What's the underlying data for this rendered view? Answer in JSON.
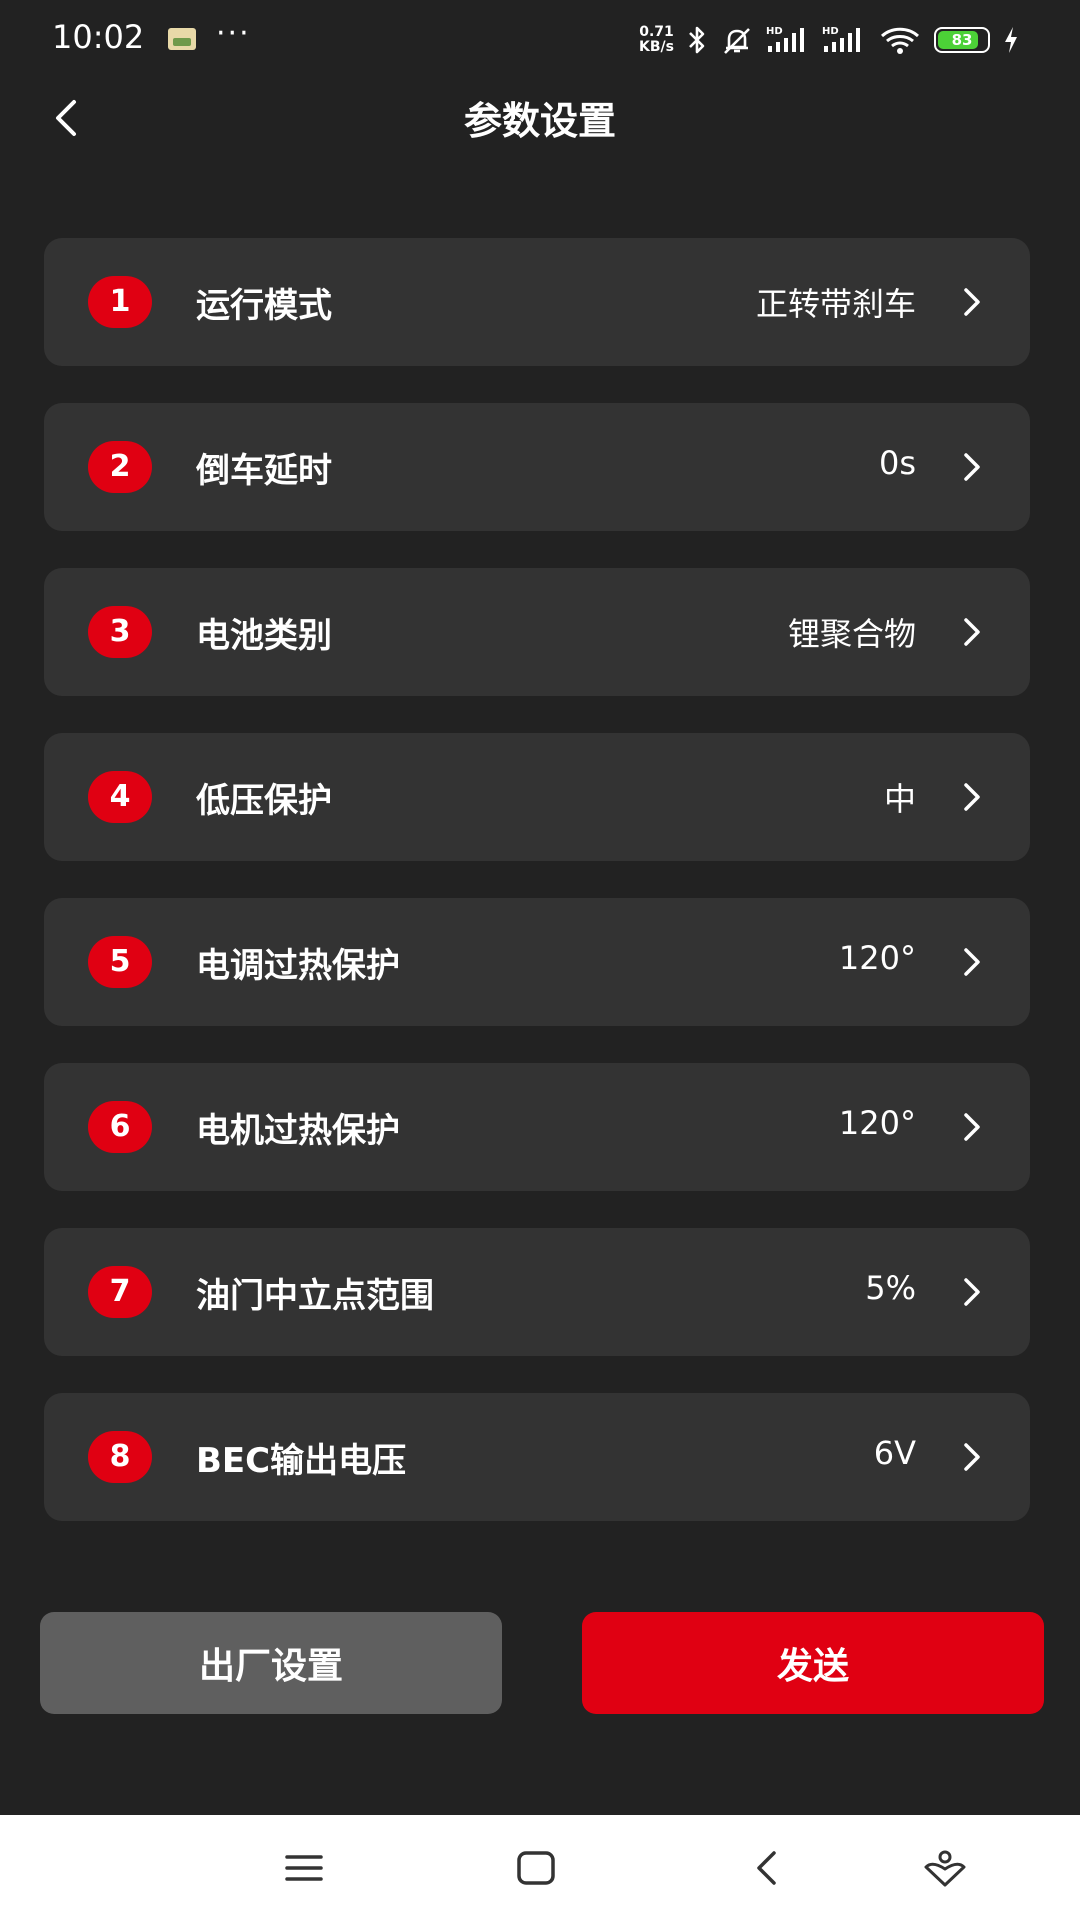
{
  "status_bar": {
    "time": "10:02",
    "more": "···",
    "net_speed_value": "0.71",
    "net_speed_unit": "KB/s",
    "battery_level": "83",
    "icons": [
      "photo-notification-icon",
      "bluetooth-icon",
      "bell-off-icon",
      "signal-hd-icon",
      "signal-hd-icon",
      "wifi-icon",
      "battery-icon",
      "charging-icon"
    ]
  },
  "header": {
    "title": "参数设置",
    "back_icon": "chevron-left-icon"
  },
  "settings": [
    {
      "index": "1",
      "label": "运行模式",
      "value": "正转带刹车"
    },
    {
      "index": "2",
      "label": "倒车延时",
      "value": "0s"
    },
    {
      "index": "3",
      "label": "电池类别",
      "value": "锂聚合物"
    },
    {
      "index": "4",
      "label": "低压保护",
      "value": "中"
    },
    {
      "index": "5",
      "label": "电调过热保护",
      "value": "120°"
    },
    {
      "index": "6",
      "label": "电机过热保护",
      "value": "120°"
    },
    {
      "index": "7",
      "label": "油门中立点范围",
      "value": "5%"
    },
    {
      "index": "8",
      "label": "BEC输出电压",
      "value": "6V"
    }
  ],
  "actions": {
    "factory_reset_label": "出厂设置",
    "send_label": "发送"
  },
  "nav_bar": {
    "icons": [
      "menu-icon",
      "home-icon",
      "back-icon",
      "assistant-icon"
    ]
  },
  "colors": {
    "background": "#222222",
    "row_background": "#333333",
    "accent": "#e00012",
    "secondary_button": "#5f5f5f",
    "nav_bar": "#ffffff"
  }
}
